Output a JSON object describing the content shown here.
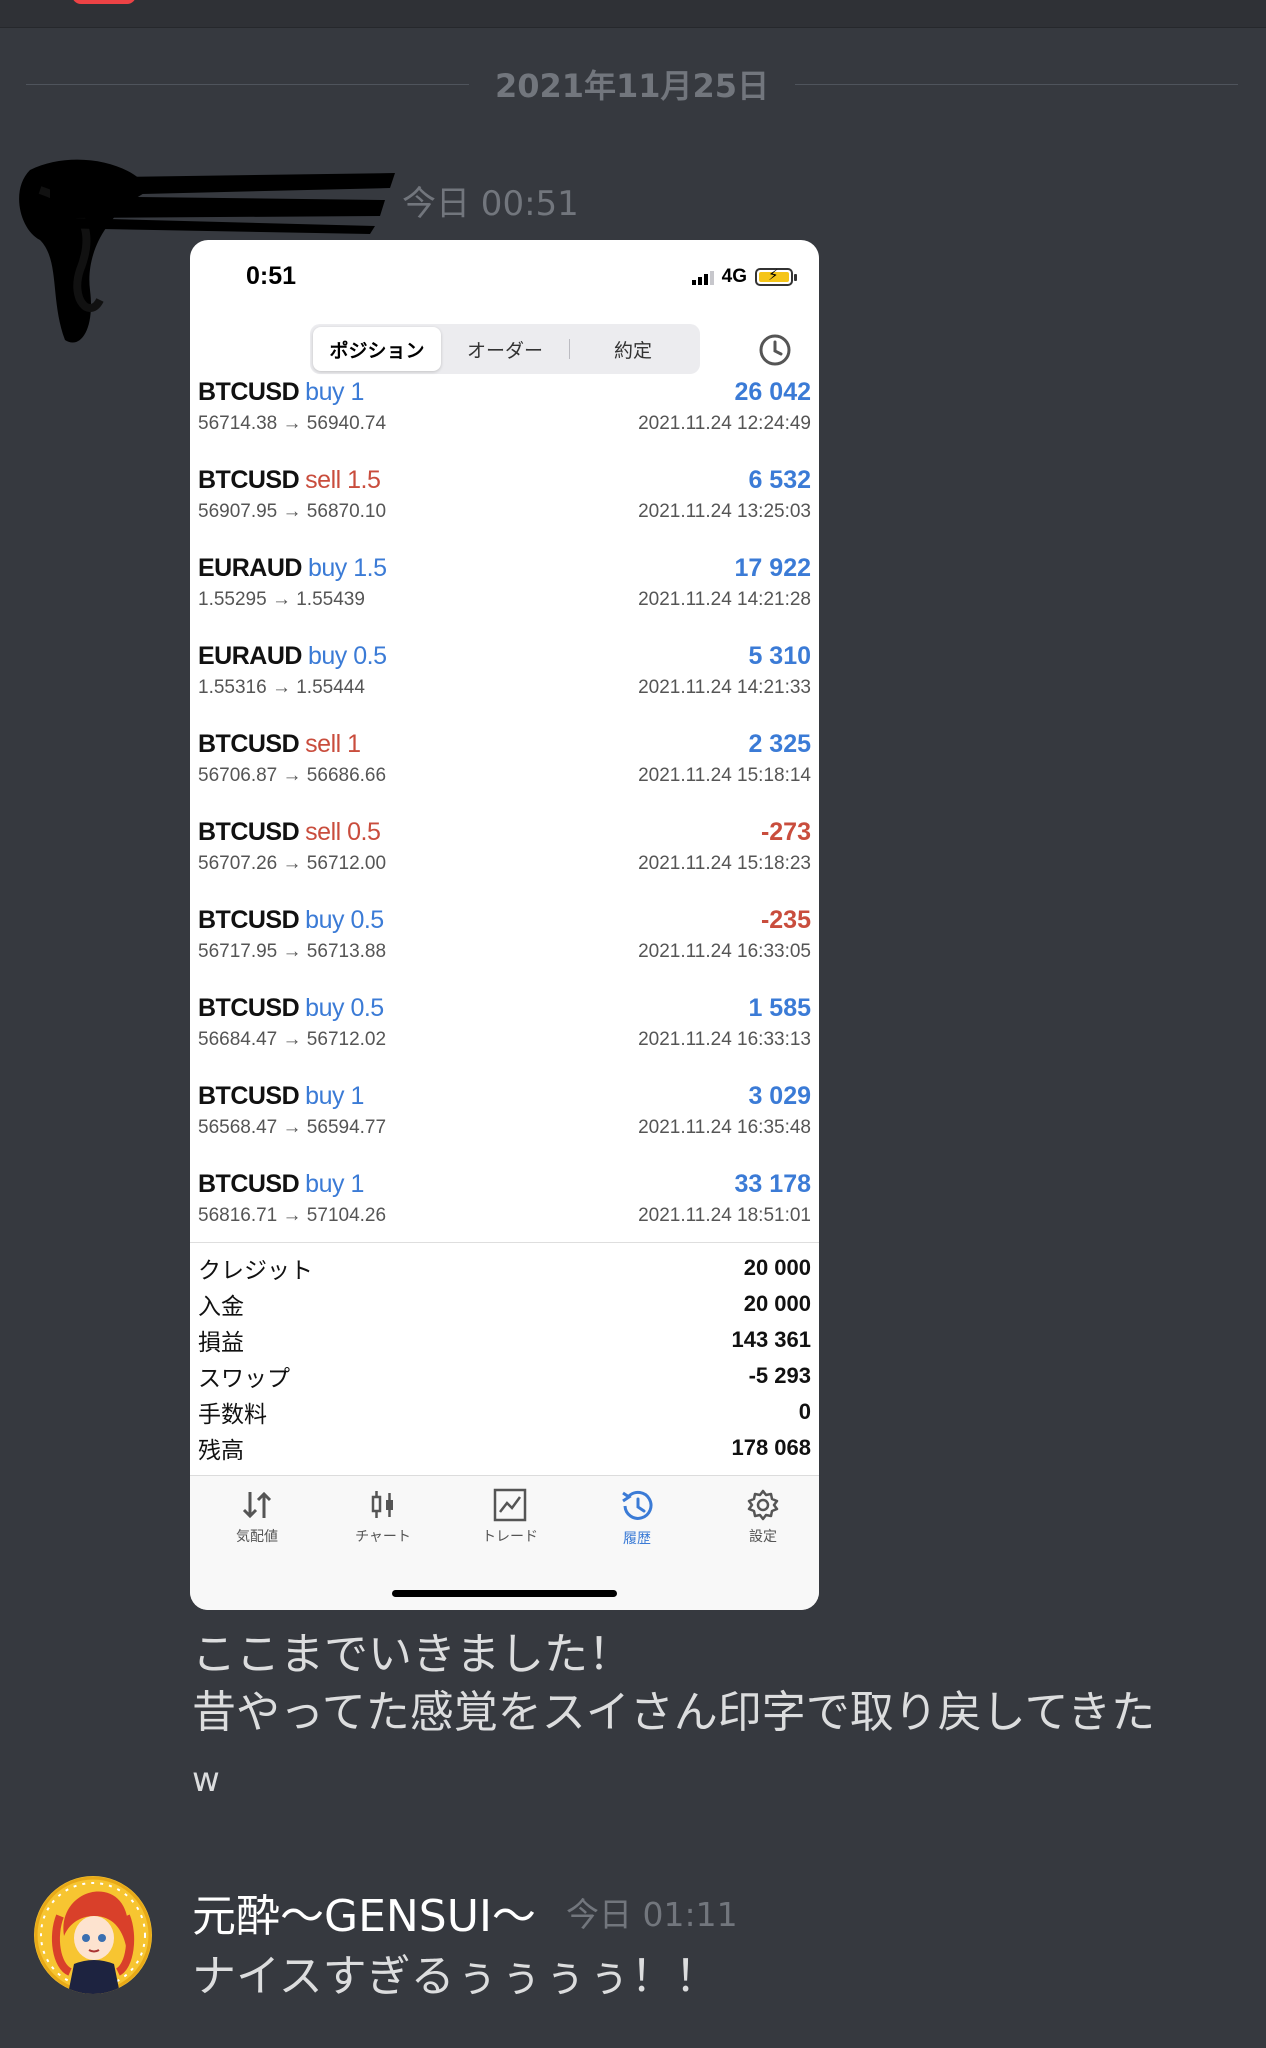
{
  "date_divider": "2021年11月25日",
  "message1": {
    "timestamp": "今日 00:51",
    "lines": [
      "ここまでいきました！",
      "昔やってた感覚をスイさん印字で取り戻してきた",
      "w"
    ]
  },
  "phone": {
    "status_time": "0:51",
    "network": "4G",
    "segments": [
      "ポジション",
      "オーダー",
      "約定"
    ],
    "active_segment": "ポジション",
    "deals": [
      {
        "symbol": "BTCUSD",
        "side": "buy",
        "volume": "1",
        "profit": "26 042",
        "prices": "56714.38 → 56940.74",
        "time": "2021.11.24 12:24:49"
      },
      {
        "symbol": "BTCUSD",
        "side": "sell",
        "volume": "1.5",
        "profit": "6 532",
        "prices": "56907.95 → 56870.10",
        "time": "2021.11.24 13:25:03"
      },
      {
        "symbol": "EURAUD",
        "side": "buy",
        "volume": "1.5",
        "profit": "17 922",
        "prices": "1.55295 → 1.55439",
        "time": "2021.11.24 14:21:28"
      },
      {
        "symbol": "EURAUD",
        "side": "buy",
        "volume": "0.5",
        "profit": "5 310",
        "prices": "1.55316 → 1.55444",
        "time": "2021.11.24 14:21:33"
      },
      {
        "symbol": "BTCUSD",
        "side": "sell",
        "volume": "1",
        "profit": "2 325",
        "prices": "56706.87 → 56686.66",
        "time": "2021.11.24 15:18:14"
      },
      {
        "symbol": "BTCUSD",
        "side": "sell",
        "volume": "0.5",
        "profit": "-273",
        "prices": "56707.26 → 56712.00",
        "time": "2021.11.24 15:18:23"
      },
      {
        "symbol": "BTCUSD",
        "side": "buy",
        "volume": "0.5",
        "profit": "-235",
        "prices": "56717.95 → 56713.88",
        "time": "2021.11.24 16:33:05"
      },
      {
        "symbol": "BTCUSD",
        "side": "buy",
        "volume": "0.5",
        "profit": "1 585",
        "prices": "56684.47 → 56712.02",
        "time": "2021.11.24 16:33:13"
      },
      {
        "symbol": "BTCUSD",
        "side": "buy",
        "volume": "1",
        "profit": "3 029",
        "prices": "56568.47 → 56594.77",
        "time": "2021.11.24 16:35:48"
      },
      {
        "symbol": "BTCUSD",
        "side": "buy",
        "volume": "1",
        "profit": "33 178",
        "prices": "56816.71 → 57104.26",
        "time": "2021.11.24 18:51:01"
      }
    ],
    "summary": [
      {
        "label": "クレジット",
        "value": "20 000"
      },
      {
        "label": "入金",
        "value": "20 000"
      },
      {
        "label": "損益",
        "value": "143 361"
      },
      {
        "label": "スワップ",
        "value": "-5 293"
      },
      {
        "label": "手数料",
        "value": "0"
      },
      {
        "label": "残高",
        "value": "178 068"
      }
    ],
    "tabs": [
      {
        "label": "気配値",
        "icon": "quotes-arrows-icon"
      },
      {
        "label": "チャート",
        "icon": "candlestick-chart-icon"
      },
      {
        "label": "トレード",
        "icon": "trade-line-chart-icon"
      },
      {
        "label": "履歴",
        "icon": "history-clock-icon"
      },
      {
        "label": "設定",
        "icon": "gear-icon"
      }
    ],
    "active_tab": "履歴",
    "colors": {
      "buy": "#3b7bd6",
      "sell": "#c94d3d"
    }
  },
  "message2": {
    "author": "元酔〜GENSUI〜",
    "timestamp": "今日 01:11",
    "text": "ナイスすぎるぅぅぅぅ！！"
  },
  "colors": {
    "background": "#36393f",
    "muted_text": "#72767d",
    "text": "#dcddde"
  }
}
